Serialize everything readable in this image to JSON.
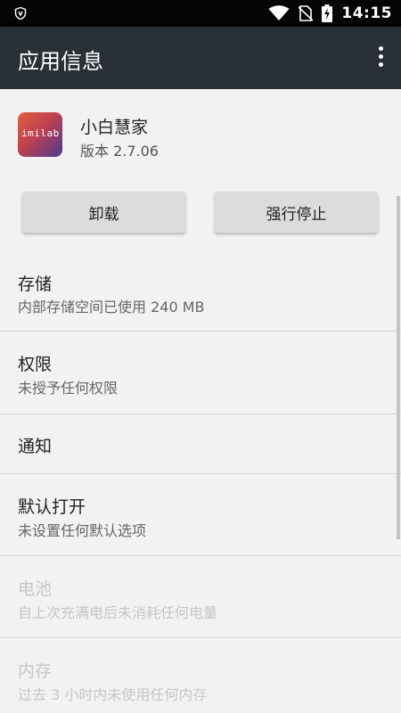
{
  "status_bar": {
    "time": "14:15",
    "icons": [
      "shield-icon",
      "wifi-icon",
      "no-sim-icon",
      "battery-charging-icon"
    ]
  },
  "app_bar": {
    "title": "应用信息",
    "more_icon": "more-vert-icon"
  },
  "app": {
    "name": "小白慧家",
    "version": "版本 2.7.06",
    "icon_text": "imilab"
  },
  "buttons": {
    "uninstall": "卸载",
    "force_stop": "强行停止"
  },
  "items": [
    {
      "title": "存储",
      "subtitle": "内部存储空间已使用 240 MB",
      "enabled": true
    },
    {
      "title": "权限",
      "subtitle": "未授予任何权限",
      "enabled": true
    },
    {
      "title": "通知",
      "subtitle": "",
      "enabled": true
    },
    {
      "title": "默认打开",
      "subtitle": "未设置任何默认选项",
      "enabled": true
    },
    {
      "title": "电池",
      "subtitle": "自上次充满电后未消耗任何电量",
      "enabled": false
    },
    {
      "title": "内存",
      "subtitle": "过去 3 小时内未使用任何内存",
      "enabled": false
    }
  ]
}
